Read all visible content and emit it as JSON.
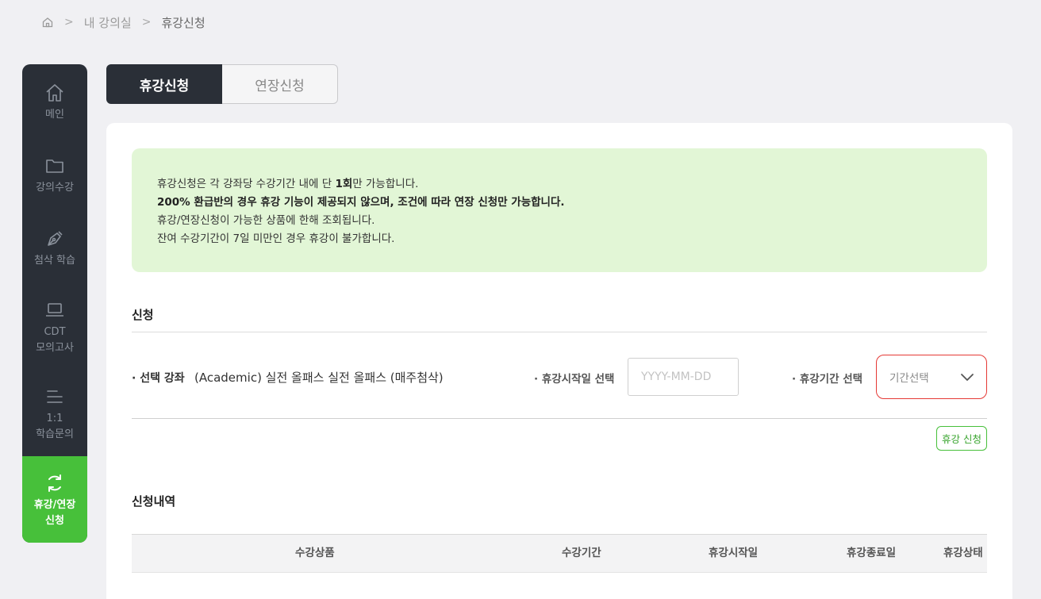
{
  "breadcrumb": {
    "home_icon": "home-icon",
    "separator": ">",
    "level1": "내 강의실",
    "current": "휴강신청"
  },
  "sidebar": {
    "items": [
      {
        "icon": "house-icon",
        "label": "메인"
      },
      {
        "icon": "folder-icon",
        "label": "강의수강"
      },
      {
        "icon": "pen-nib-icon",
        "label": "첨삭 학습"
      },
      {
        "icon": "laptop-icon",
        "label": "CDT\n모의고사"
      },
      {
        "icon": "menu-lines-icon",
        "label": "1:1\n학습문의"
      },
      {
        "icon": "refresh-icon",
        "label": "휴강/연장\n신청"
      }
    ]
  },
  "tabs": [
    {
      "label": "휴강신청"
    },
    {
      "label": "연장신청"
    }
  ],
  "notice": {
    "line1_pre": "휴강신청은 각 강좌당 수강기간 내에 단 ",
    "line1_bold": "1회",
    "line1_post": "만 가능합니다.",
    "line2": "200% 환급반의 경우 휴강 기능이 제공되지 않으며, 조건에 따라 연장 신청만 가능합니다.",
    "line3": "휴강/연장신청이 가능한 상품에 한해 조회됩니다.",
    "line4": "잔여 수강기간이 7일 미만인 경우 휴강이 불가합니다."
  },
  "apply_section": {
    "title": "신청",
    "course_label": "· 선택 강좌",
    "course_name": "(Academic) 실전 올패스 실전 올패스 (매주첨삭)",
    "start_label": "· 휴강시작일 선택",
    "start_placeholder": "YYYY-MM-DD",
    "period_label": "· 휴강기간 선택",
    "period_value": "기간선택",
    "apply_button": "휴강 신청"
  },
  "history_section": {
    "title": "신청내역",
    "columns": [
      "수강상품",
      "수강기간",
      "휴강시작일",
      "휴강종료일",
      "휴강상태"
    ]
  },
  "colors": {
    "accent": "#47c03a",
    "sidebar_bg": "#2a2f37",
    "notice_bg": "#e2f6d6",
    "select_border": "#e53935"
  }
}
